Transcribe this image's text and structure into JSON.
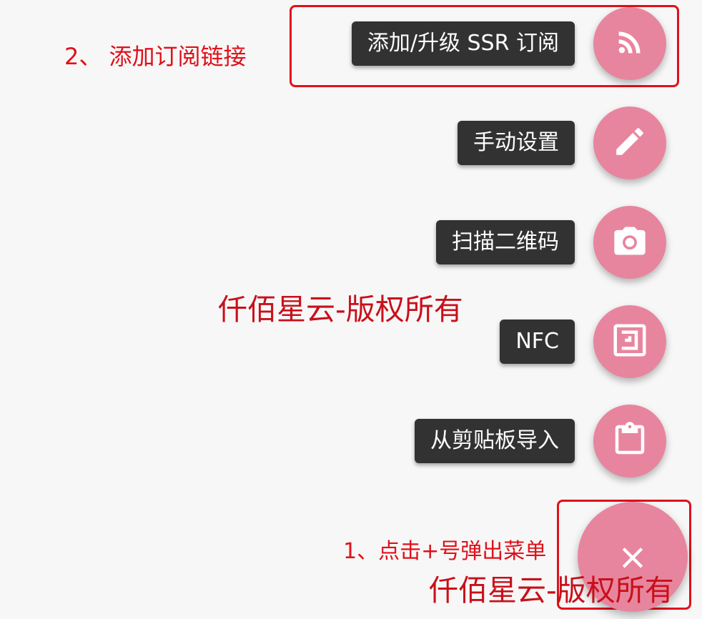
{
  "menu_items": [
    {
      "label": "添加/升级 SSR 订阅",
      "icon": "rss-icon"
    },
    {
      "label": "手动设置",
      "icon": "pencil-icon"
    },
    {
      "label": "扫描二维码",
      "icon": "camera-icon"
    },
    {
      "label": "NFC",
      "icon": "nfc-icon"
    },
    {
      "label": "从剪贴板导入",
      "icon": "clipboard-icon"
    }
  ],
  "main_fab": {
    "icon": "close-icon",
    "glyph": "×"
  },
  "annotations": {
    "step1": "1、点击+号弹出菜单",
    "step2": "2、 添加订阅链接"
  },
  "watermark_text": "仟佰星云-版权所有",
  "colors": {
    "fab": "#e8859e",
    "label_bg": "#323232",
    "annotation": "#e0101a",
    "background": "#f7f7f7"
  }
}
